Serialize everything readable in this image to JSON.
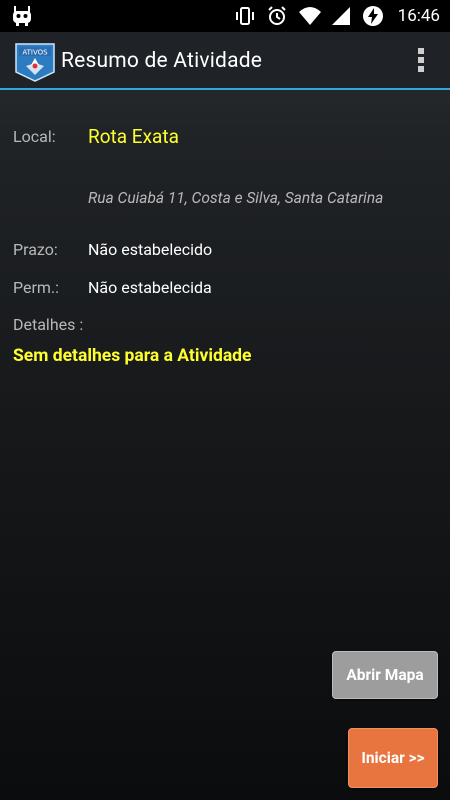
{
  "status_bar": {
    "time": "16:46",
    "icons": [
      "android-robot-icon",
      "vibrate-icon",
      "alarm-icon",
      "wifi-icon",
      "signal-icon",
      "battery-charging-icon"
    ]
  },
  "action_bar": {
    "logo_text": "ATIVOS",
    "title": "Resumo de Atividade",
    "overflow_icon": "overflow-menu-icon",
    "accent_color": "#33a6dd"
  },
  "activity": {
    "local_label": "Local:",
    "local_name": "Rota Exata",
    "address": "Rua Cuiabá 11, Costa e Silva, Santa Catarina",
    "deadline_label": "Prazo:",
    "deadline_value": "Não estabelecido",
    "permanence_label": "Perm.:",
    "permanence_value": "Não estabelecida",
    "details_label": "Detalhes :",
    "details_value": "Sem detalhes para a Atividade"
  },
  "buttons": {
    "open_map": "Abrir Mapa",
    "start": "Iniciar >>"
  },
  "colors": {
    "highlight_yellow": "#ffff2e",
    "start_button": "#e8753f",
    "map_button": "#9d9d9d"
  }
}
